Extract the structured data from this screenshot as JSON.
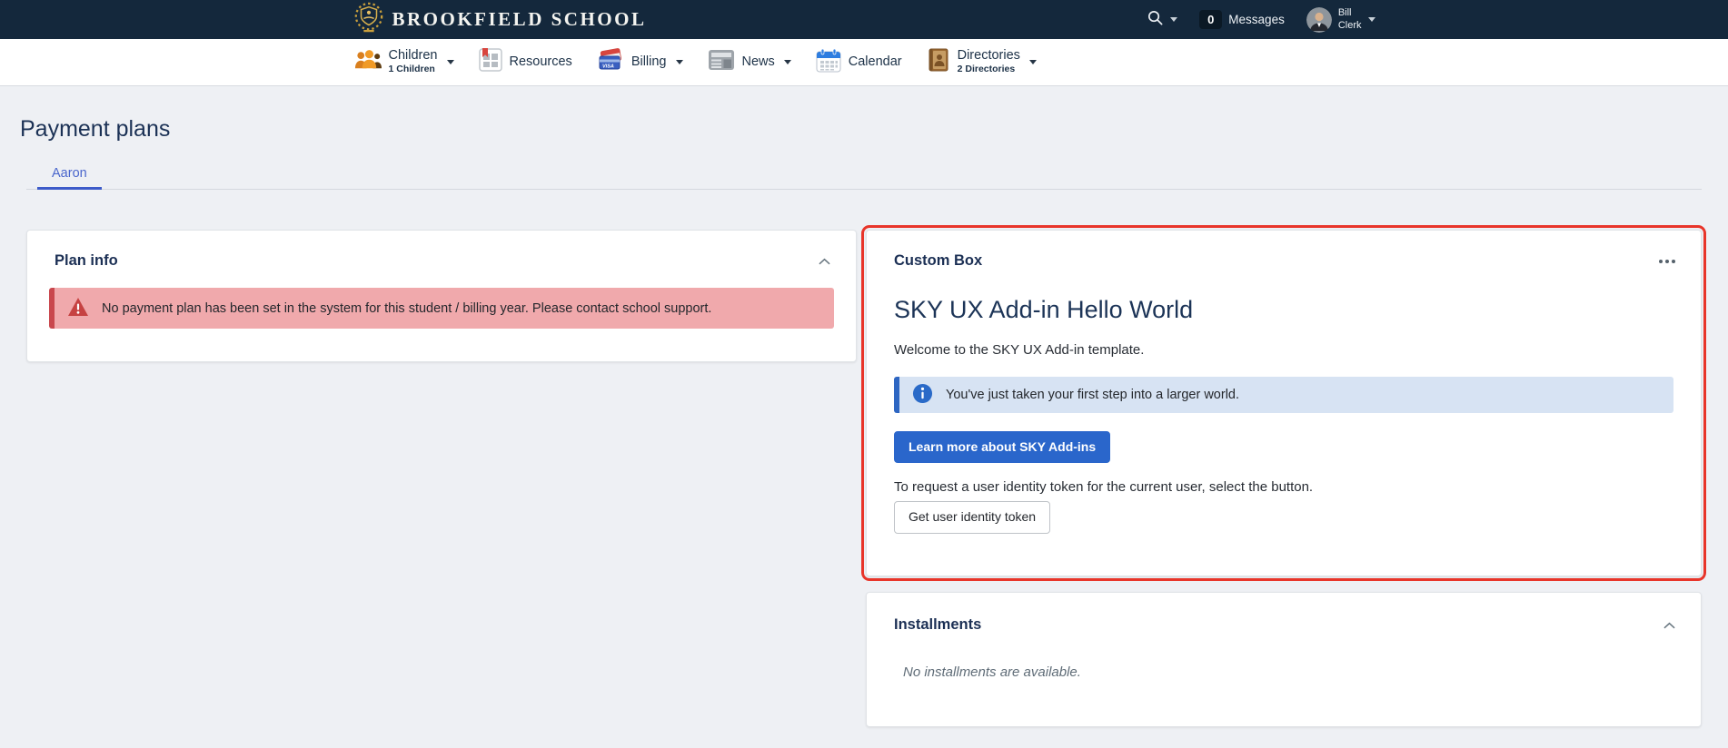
{
  "topbar": {
    "school_name": "BROOKFIELD SCHOOL",
    "messages_count": "0",
    "messages_label": "Messages",
    "user_name_line1": "Bill",
    "user_name_line2": "Clerk"
  },
  "nav": {
    "items": [
      {
        "label": "Children",
        "sublabel": "1 Children"
      },
      {
        "label": "Resources"
      },
      {
        "label": "Billing"
      },
      {
        "label": "News"
      },
      {
        "label": "Calendar"
      },
      {
        "label": "Directories",
        "sublabel": "2 Directories"
      }
    ]
  },
  "page": {
    "title": "Payment plans"
  },
  "tabs": {
    "active": "Aaron"
  },
  "plan_info": {
    "title": "Plan info",
    "alert_text": "No payment plan has been set in the system for this student / billing year. Please contact school support."
  },
  "custom_box": {
    "title": "Custom Box",
    "heading": "SKY UX Add-in Hello World",
    "welcome_text": "Welcome to the SKY UX Add-in template.",
    "info_text": "You've just taken your first step into a larger world.",
    "learn_more_button": "Learn more about SKY Add-ins",
    "token_instruction": "To request a user identity token for the current user, select the button.",
    "token_button": "Get user identity token"
  },
  "installments": {
    "title": "Installments",
    "empty_text": "No installments are available."
  },
  "colors": {
    "topbar_bg": "#14283c",
    "accent_blue": "#2a66cb",
    "tab_blue": "#4a66cc",
    "danger_bg": "#f0a9ac",
    "danger_border": "#c9474d",
    "info_bg": "#d7e3f3",
    "info_border": "#2e66c2",
    "highlight_red": "#e8352a",
    "heading_navy": "#1b3155"
  }
}
